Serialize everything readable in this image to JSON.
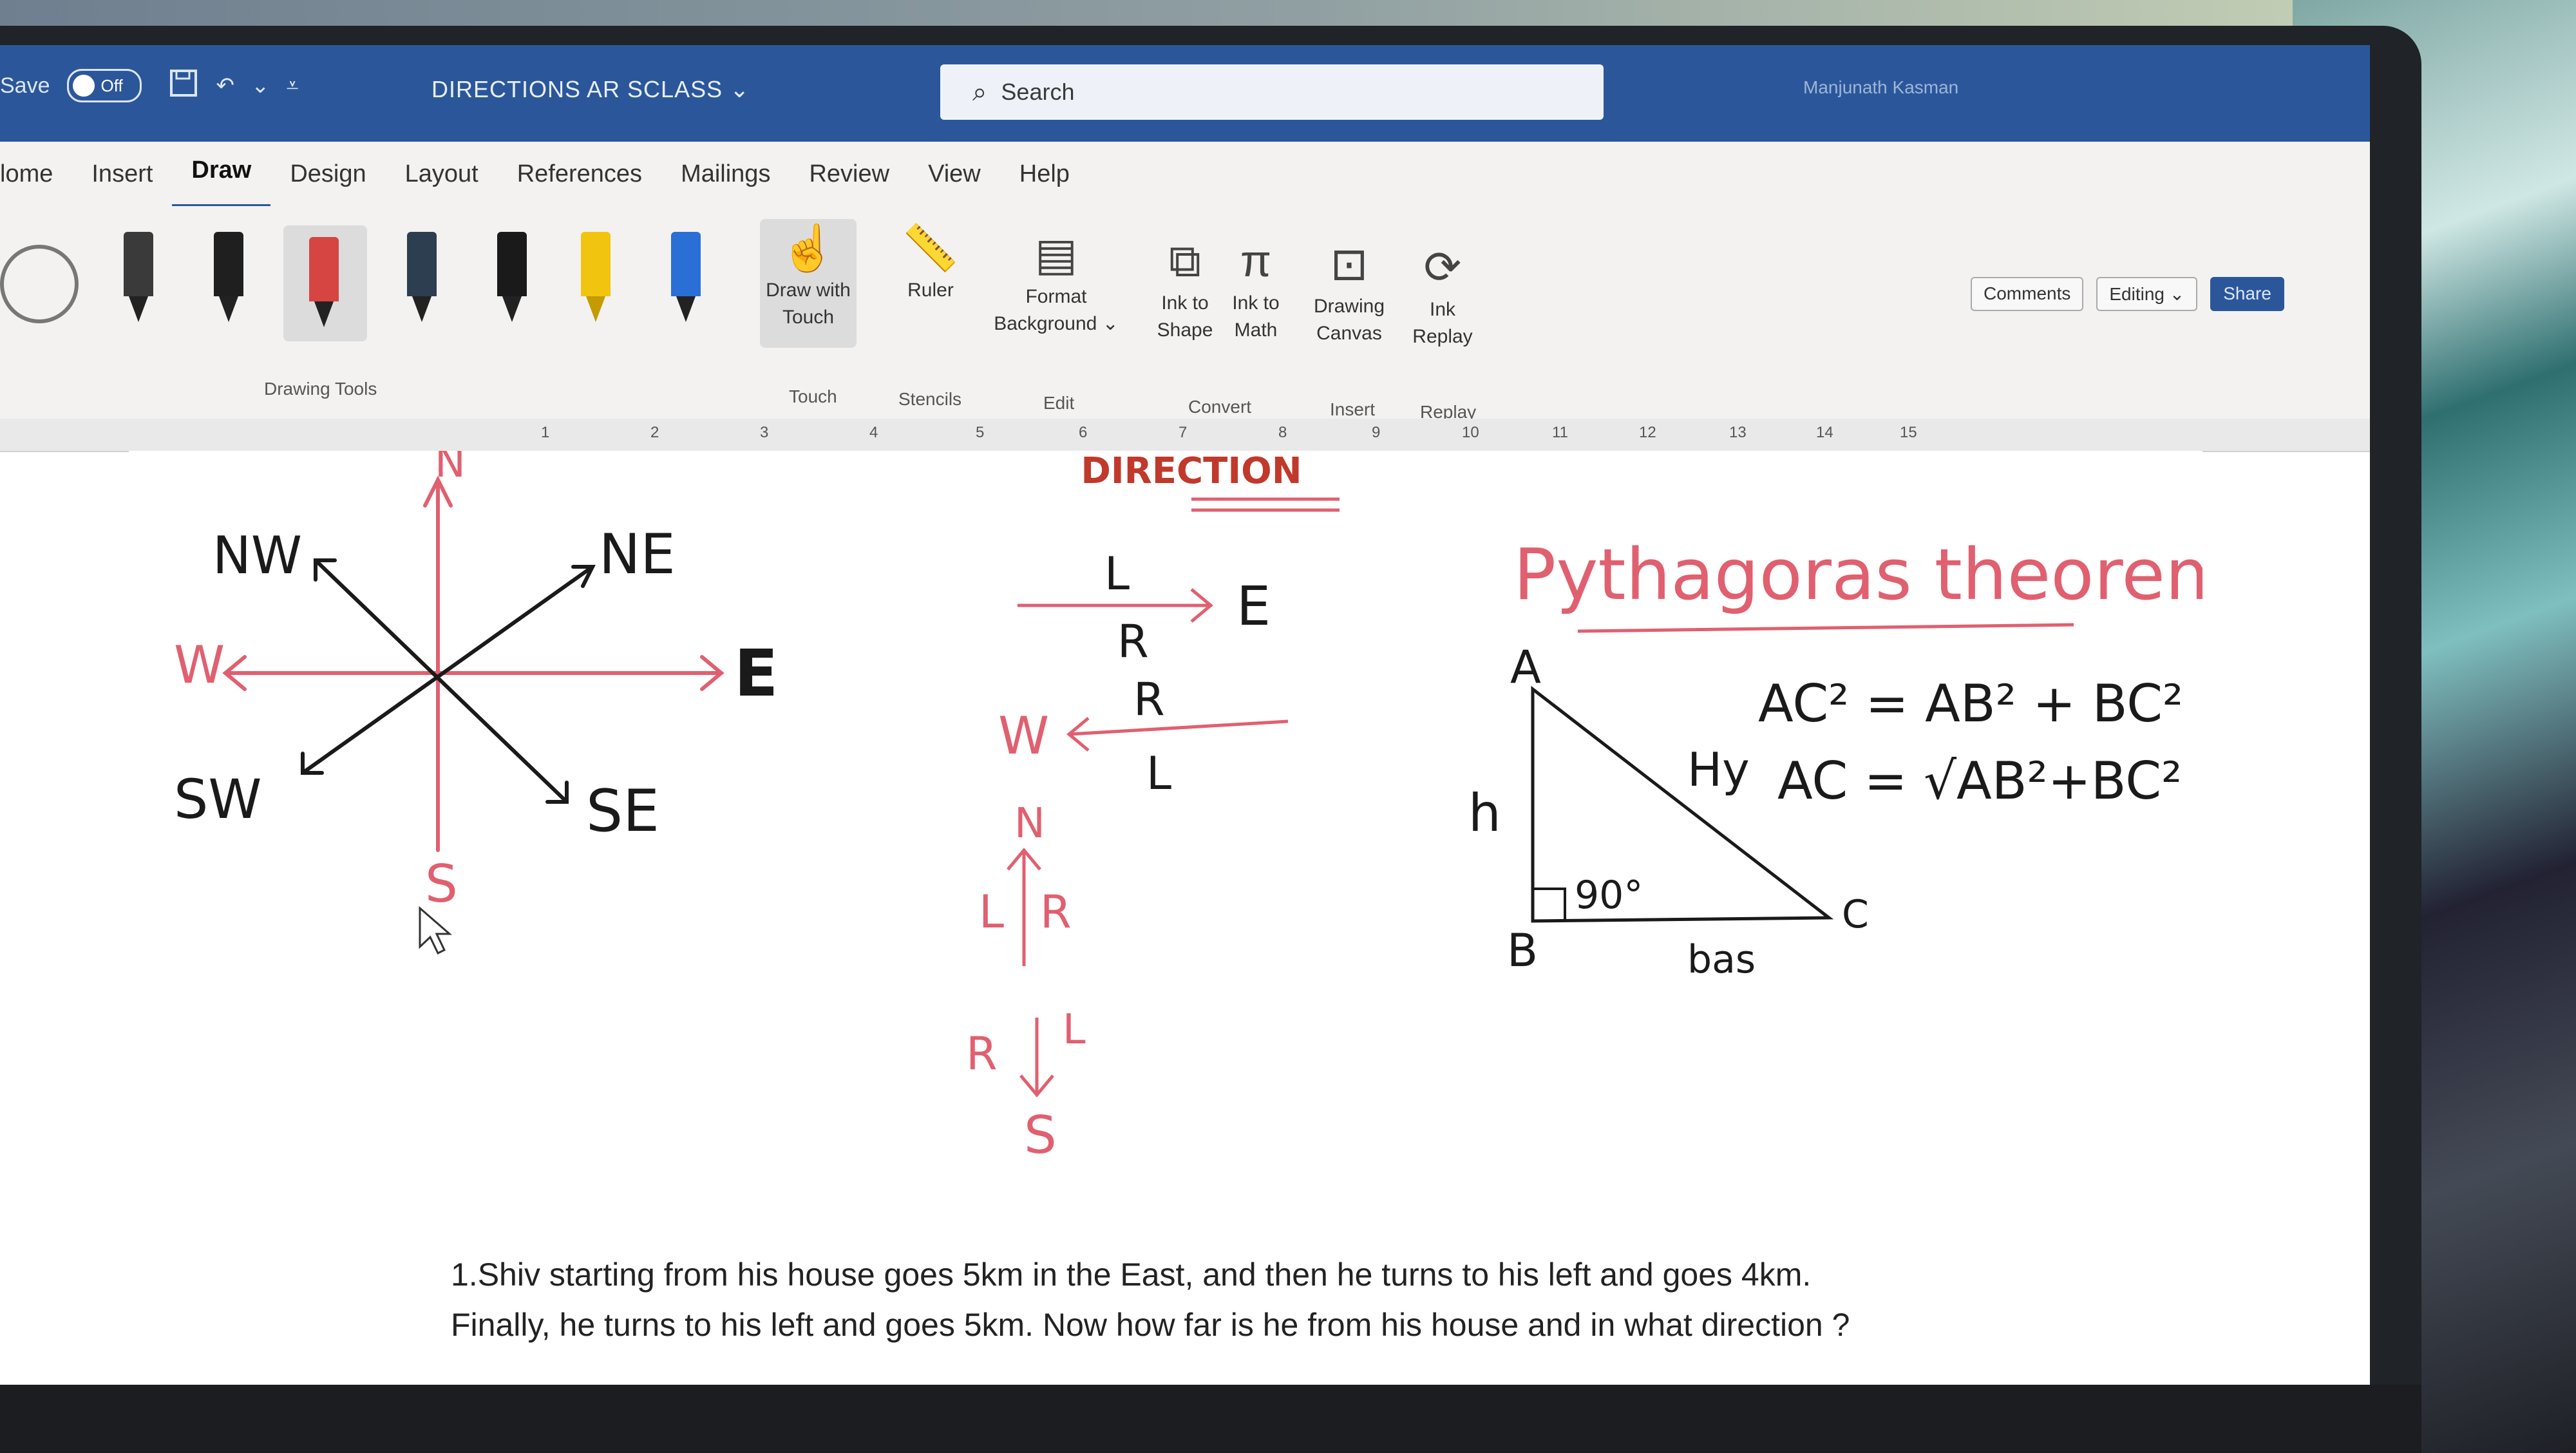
{
  "window": {
    "autosave_label": "Save",
    "autosave_state": "Off",
    "document_title": "DIRECTIONS AR SCLASS ⌄",
    "search_placeholder": "Search",
    "user": "Manjunath Kasman"
  },
  "tabs": [
    "lome",
    "Insert",
    "Draw",
    "Design",
    "Layout",
    "References",
    "Mailings",
    "Review",
    "View",
    "Help"
  ],
  "active_tab": "Draw",
  "ribbon": {
    "groups": {
      "drawing_tools": "Drawing Tools",
      "touch": "Touch",
      "stencils": "Stencils",
      "edit": "Edit",
      "convert": "Convert",
      "insert": "Insert",
      "replay": "Replay"
    },
    "buttons": {
      "draw_with_touch": [
        "Draw with",
        "Touch"
      ],
      "ruler": "Ruler",
      "format_background": [
        "Format",
        "Background ⌄"
      ],
      "ink_to_shape": [
        "Ink to",
        "Shape"
      ],
      "ink_to_math": [
        "Ink to",
        "Math"
      ],
      "drawing_canvas": [
        "Drawing",
        "Canvas"
      ],
      "ink_replay": [
        "Ink",
        "Replay"
      ]
    },
    "right": {
      "comments": "Comments",
      "editing": "Editing ⌄",
      "share": "Share"
    },
    "pen_colors": [
      "#3a3a3a",
      "#1f1f1f",
      "#d64541",
      "#2c3e50",
      "#1a1a1a",
      "#f1c40f",
      "#2a6fd6"
    ]
  },
  "ruler_numbers": [
    "1",
    "2",
    "3",
    "4",
    "5",
    "6",
    "7",
    "8",
    "9",
    "10",
    "11",
    "12",
    "13",
    "14",
    "15"
  ],
  "document": {
    "heading": "DIRECTION",
    "compass": {
      "labels": [
        "N",
        "NE",
        "E",
        "SE",
        "S",
        "SW",
        "W",
        "NW"
      ]
    },
    "turns": {
      "east_left": "L",
      "east_right": "R",
      "east_dest": "E",
      "west_right": "R",
      "west_left": "L",
      "west_dest": "W",
      "north_dest": "N",
      "north_left": "L",
      "north_right": "R",
      "south_right": "R",
      "south_left": "L",
      "south_dest": "S"
    },
    "pythagoras": {
      "title": "Pythagoras theorem",
      "vertex_a": "A",
      "vertex_b": "B",
      "vertex_c": "C",
      "hyp": "Hy",
      "height": "h",
      "base": "bas",
      "angle": "90°",
      "eq1": "AC² = AB² + BC²",
      "eq2": "AC = √AB²+BC²"
    },
    "question_line1": "1.Shiv starting from his house goes 5km in the East, and then he turns to his left and goes 4km.",
    "question_line2": "Finally, he turns to his left and goes 5km. Now how far is he from his house and in what direction ?"
  },
  "colors": {
    "title_bar": "#2b579a",
    "ribbon_bg": "#f3f2f1",
    "red_ink": "#e06070",
    "black_ink": "#1a1a1a"
  }
}
